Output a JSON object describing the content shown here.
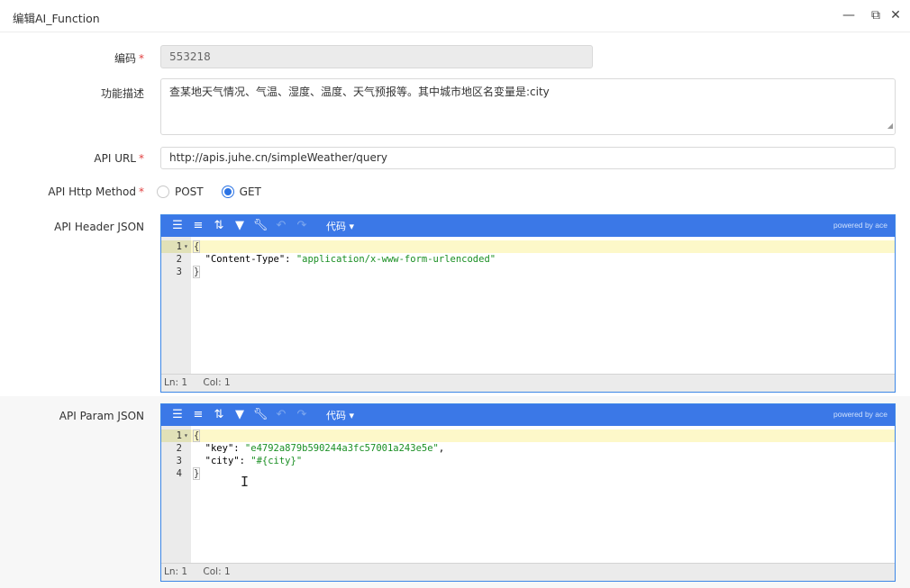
{
  "window": {
    "title": "编辑AI_Function",
    "minimize_glyph": "—",
    "maximize_glyph": "⧉",
    "close_glyph": "✕"
  },
  "form": {
    "code_label": "编码",
    "code_value": "553218",
    "desc_label": "功能描述",
    "desc_value": "查某地天气情况、气温、湿度、温度、天气预报等。其中城市地区名变量是:city",
    "url_label": "API URL",
    "url_value": "http://apis.juhe.cn/simpleWeather/query",
    "method_label": "API Http Method",
    "method_options": [
      "POST",
      "GET"
    ],
    "method_selected": "GET",
    "header_label": "API Header JSON",
    "param_label": "API Param JSON",
    "required_mark": "*"
  },
  "editor_toolbar": {
    "mode_label": "代码 ▾",
    "powered_by": "powered by ace",
    "icons": [
      "format-icon",
      "compact-icon",
      "sort-icon",
      "filter-icon",
      "repair-icon",
      "undo-icon",
      "redo-icon"
    ]
  },
  "header_editor": {
    "lines": [
      "1",
      "2",
      "3"
    ],
    "code": {
      "open": "{",
      "key1": "\"Content-Type\"",
      "val1": "\"application/x-www-form-urlencoded\"",
      "close": "}"
    },
    "status_ln": "Ln: 1",
    "status_col": "Col: 1"
  },
  "param_editor": {
    "lines": [
      "1",
      "2",
      "3",
      "4"
    ],
    "code": {
      "open": "{",
      "key1": "\"key\"",
      "val1": "\"e4792a879b590244a3fc57001a243e5e\"",
      "key2": "\"city\"",
      "val2": "\"#{city}\"",
      "close": "}"
    },
    "status_ln": "Ln: 1",
    "status_col": "Col: 1"
  },
  "colors": {
    "accent": "#3b78e7",
    "required": "#e04040",
    "string": "#1a8f23",
    "active_line": "#fdf8c9"
  }
}
